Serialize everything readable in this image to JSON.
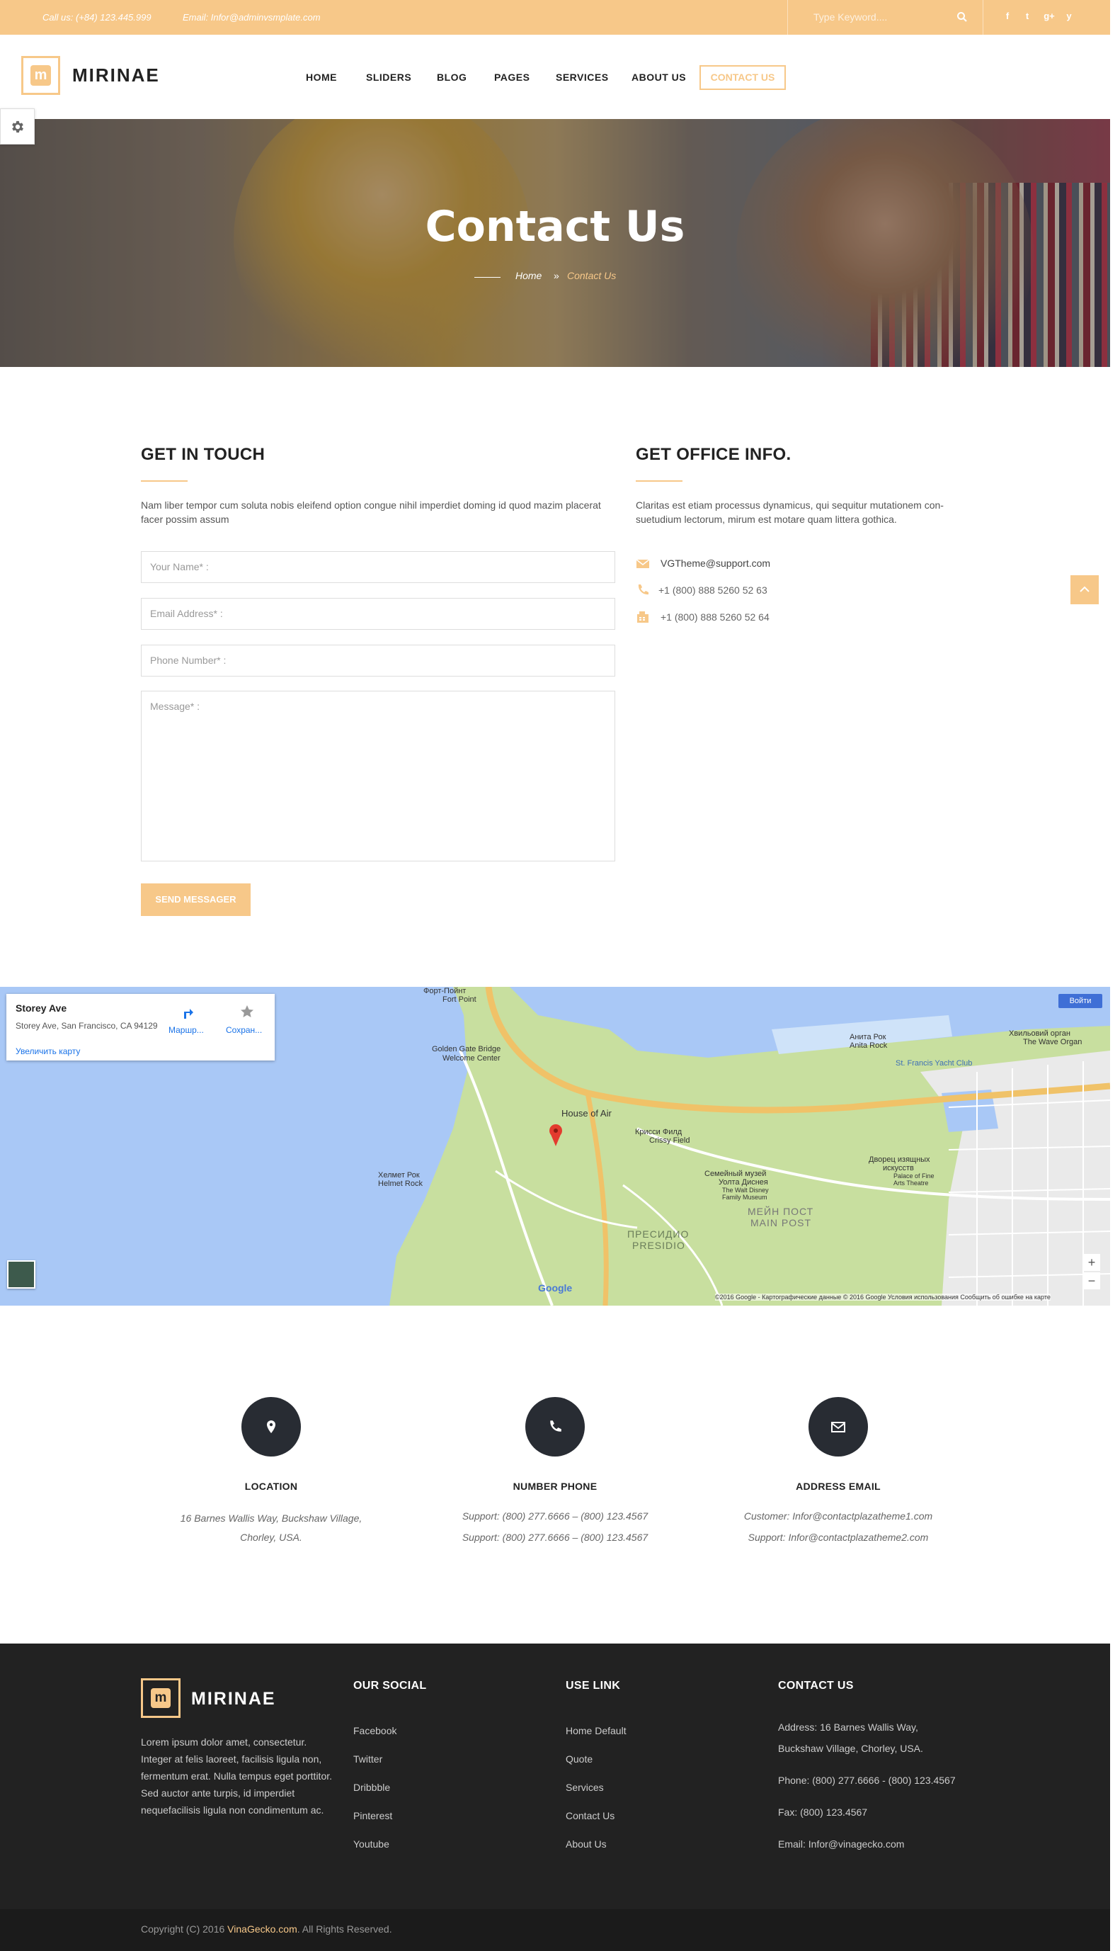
{
  "colors": {
    "accent": "#f7c889",
    "dark": "#222222",
    "circle": "#282c33"
  },
  "topbar": {
    "phone": "Call us: (+84) 123.445.999",
    "email": "Email: Infor@adminvsmplate.com",
    "search_placeholder": "Type Keyword....",
    "social": [
      "f",
      "t",
      "g+",
      "y"
    ]
  },
  "header": {
    "logo_letter": "m",
    "logo_text": "MIRINAE",
    "nav": [
      "HOME",
      "SLIDERS",
      "BLOG",
      "PAGES",
      "SERVICES",
      "ABOUT US",
      "CONTACT US"
    ]
  },
  "hero": {
    "title": "Contact Us",
    "crumb_home": "Home",
    "crumb_sep": "»",
    "crumb_current": "Contact Us"
  },
  "touch": {
    "title": "GET IN TOUCH",
    "text": "Nam liber tempor cum soluta nobis eleifend option congue nihil imperdiet doming id quod mazim placerat facer possim assum",
    "name": "Your Name* :",
    "email": "Email Address* :",
    "phone": "Phone Number* :",
    "message": "Message* :",
    "send": "SEND MESSAGER"
  },
  "office": {
    "title": "GET OFFICE INFO.",
    "text": "Claritas est etiam processus dynamicus, qui sequitur mutationem con-suetudium lectorum, mirum est motare quam littera gothica.",
    "email": "VGTheme@support.com",
    "phone": "+1 (800) 888 5260 52 63",
    "fax": "+1 (800) 888 5260 52 64"
  },
  "map": {
    "place": "Storey Ave",
    "address": "Storey Ave, San Francisco, CA 94129",
    "enlarge": "Увеличить карту",
    "route": "Маршр...",
    "save": "Сохран...",
    "login": "Войти",
    "labels": {
      "fort": "Форт-Пойнт",
      "fort2": "Fort Point",
      "gg": "Golden Gate Bridge",
      "gg2": "Welcome Center",
      "house": "House of Air",
      "crissy": "Крисси Филд",
      "crissy2": "Crissy Field",
      "helmet": "Хелмет Рок",
      "helmet2": "Helmet Rock",
      "anita": "Анита Рок",
      "anita2": "Anita Rock",
      "yacht": "St. Francis Yacht Club",
      "wave": "Хвильовий орган",
      "wave2": "The Wave Organ",
      "family": "Семейный музей",
      "family2": "Уолта Диснея",
      "family3": "The Walt Disney",
      "family4": "Family Museum",
      "palace": "Дворец изящных",
      "palace2": "искусств",
      "palace3": "Palace of Fine",
      "palace4": "Arts Theatre",
      "presidio": "ПРЕСИДИО",
      "presidio2": "PRESIDIO",
      "mainpost": "МЕЙН ПОСТ",
      "mainpost2": "MAIN POST",
      "google": "Google"
    },
    "footer": "©2016 Google - Картографические данные © 2016 Google   Условия использования   Сообщить об ошибке на карте"
  },
  "cards": [
    {
      "title": "LOCATION",
      "lines": [
        "16 Barnes Wallis Way, Buckshaw Village, Chorley, USA."
      ]
    },
    {
      "title": "NUMBER PHONE",
      "lines": [
        "Support: (800) 277.6666 – (800) 123.4567",
        "Support: (800) 277.6666 – (800) 123.4567"
      ]
    },
    {
      "title": "ADDRESS EMAIL",
      "lines": [
        "Customer: Infor@contactplazatheme1.com",
        "Support: Infor@contactplazatheme2.com"
      ]
    }
  ],
  "footer": {
    "about": "Lorem ipsum dolor amet, consectetur. Integer at felis laoreet, facilisis ligula non, fermentum erat. Nulla tempus eget porttitor. Sed auctor ante turpis, id imperdiet nequefacilisis ligula non condimentum ac.",
    "social_title": "OUR SOCIAL",
    "social": [
      "Facebook",
      "Twitter",
      "Dribbble",
      "Pinterest",
      "Youtube"
    ],
    "links_title": "USE LINK",
    "links": [
      "Home Default",
      "Quote",
      "Services",
      "Contact Us",
      "About Us"
    ],
    "contact_title": "CONTACT US",
    "address1": "Address: 16 Barnes Wallis Way,",
    "address2": "Buckshaw Village, Chorley, USA.",
    "phone": "Phone: (800) 277.6666 - (800) 123.4567",
    "fax": "Fax: (800) 123.4567",
    "email": "Email: Infor@vinagecko.com",
    "copy_pre": "Copyright (C) 2016 ",
    "copy_link": "VinaGecko.com",
    "copy_post": ". All Rights Reserved."
  }
}
